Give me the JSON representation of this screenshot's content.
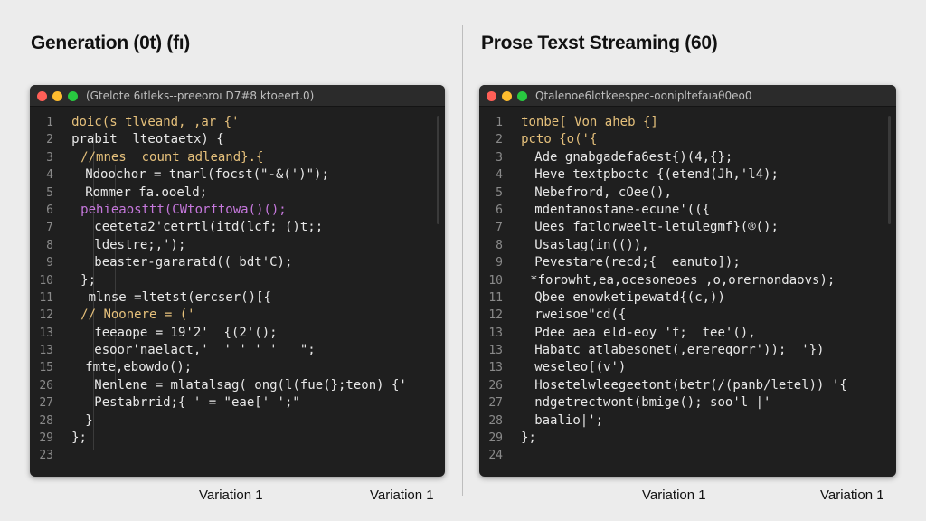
{
  "left": {
    "heading": "Generation (0t)  (fı)",
    "window_title": "(Gtelote 6ıtleks--preeoroı D7#8 ktoeert.0)",
    "lines": [
      {
        "n": "1",
        "indent": 2,
        "color": "c-y",
        "text": "doic(s tlveand, ,ar {'"
      },
      {
        "n": "2",
        "indent": 2,
        "color": "c-w",
        "text": "prabit  lteotaetx) {"
      },
      {
        "n": "3",
        "indent": 4,
        "color": "c-y",
        "text": "//mnes  count adleand}.{"
      },
      {
        "n": "4",
        "indent": 5,
        "color": "c-w",
        "text": "Ndoochor = tnarl(focst(\"-&(')\");"
      },
      {
        "n": "5",
        "indent": 5,
        "color": "c-w",
        "text": "Rommer fa.ooeld;"
      },
      {
        "n": "6",
        "indent": 4,
        "color": "c-p",
        "text": "pehieaosttt(CWtorftowa()();"
      },
      {
        "n": "7",
        "indent": 7,
        "color": "c-w",
        "text": "ceeteta2'cetrtl(itd(lcf; ()t;;"
      },
      {
        "n": "8",
        "indent": 7,
        "color": "c-w",
        "text": "ldestre;,');"
      },
      {
        "n": "9",
        "indent": 7,
        "color": "c-w",
        "text": "beaster-gararatd(( bdt'C);"
      },
      {
        "n": "10",
        "indent": 4,
        "color": "c-w",
        "text": "};"
      },
      {
        "n": "11",
        "indent": 4,
        "color": "c-w",
        "text": " mlnse =ltetst(ercser()[{"
      },
      {
        "n": "12",
        "indent": 4,
        "color": "c-y",
        "text": "// Noonere = ('"
      },
      {
        "n": "13",
        "indent": 7,
        "color": "c-w",
        "text": "feeaope = 19'2'  {(2'();"
      },
      {
        "n": "13",
        "indent": 7,
        "color": "c-w",
        "text": "esoor'naelact,'  ' ' ' '   \";"
      },
      {
        "n": "15",
        "indent": 5,
        "color": "c-w",
        "text": "fmte,ebowdo();"
      },
      {
        "n": "26",
        "indent": 7,
        "color": "c-w",
        "text": "Nenlene = mlatalsag( ong(l(fue(};teon) {'"
      },
      {
        "n": "27",
        "indent": 7,
        "color": "c-w",
        "text": "Pestabrrid;{ ' = \"eae[' ';\""
      },
      {
        "n": "28",
        "indent": 5,
        "color": "c-w",
        "text": "}"
      },
      {
        "n": "29",
        "indent": 2,
        "color": "c-w",
        "text": "};"
      },
      {
        "n": "23",
        "indent": 2,
        "color": "c-w",
        "text": ""
      }
    ],
    "caption_left": "Variation 1",
    "caption_right": "Variation 1"
  },
  "right": {
    "heading": "Prose Texst Streaming (60)",
    "window_title": "Qtalenoe6lotkeespec-oonipltefaıaθ0eo0",
    "lines": [
      {
        "n": "1",
        "indent": 2,
        "color": "c-y",
        "text": "tonbe[ Von aheb {]"
      },
      {
        "n": "2",
        "indent": 2,
        "color": "c-y",
        "text": "pcto {o('{"
      },
      {
        "n": "3",
        "indent": 5,
        "color": "c-w",
        "text": "Ade gnabgadefa6est{)(4,{};"
      },
      {
        "n": "4",
        "indent": 5,
        "color": "c-w",
        "text": "Heve textpboctc {(etend(Jh,'l4);"
      },
      {
        "n": "5",
        "indent": 5,
        "color": "c-w",
        "text": "Nebefrord, cOee(),"
      },
      {
        "n": "6",
        "indent": 5,
        "color": "c-w",
        "text": "mdentanostane-ecune'(({"
      },
      {
        "n": "7",
        "indent": 5,
        "color": "c-w",
        "text": "Uees fatlorweelt-letulegmf}(®();"
      },
      {
        "n": "8",
        "indent": 5,
        "color": "c-w",
        "text": "Usaslag(in(()),"
      },
      {
        "n": "9",
        "indent": 5,
        "color": "c-w",
        "text": "Pevestare(recd;{  eanuto]);"
      },
      {
        "n": "10",
        "indent": 4,
        "color": "c-w",
        "text": "*forowht,ea,ocesoneoes ,o,orernondaovs);"
      },
      {
        "n": "11",
        "indent": 5,
        "color": "c-w",
        "text": "Qbee enowketipewatd{(c,))"
      },
      {
        "n": "12",
        "indent": 5,
        "color": "c-w",
        "text": "rweisoe\"cd({"
      },
      {
        "n": "13",
        "indent": 5,
        "color": "c-w",
        "text": "Pdee aea eld-eoy 'f;  tee'(),"
      },
      {
        "n": "13",
        "indent": 5,
        "color": "c-w",
        "text": "Habatc atlabesonet(,erereqorr'));  '})"
      },
      {
        "n": "13",
        "indent": 5,
        "color": "c-w",
        "text": "weseleo[(v')"
      },
      {
        "n": "26",
        "indent": 5,
        "color": "c-w",
        "text": "Hosetelwleegeetont(betr(/(panb/letel)) '{"
      },
      {
        "n": "27",
        "indent": 5,
        "color": "c-w",
        "text": "ndgetrectwont(bmige(); soo'l |'"
      },
      {
        "n": "28",
        "indent": 5,
        "color": "c-w",
        "text": "baalio|';"
      },
      {
        "n": "29",
        "indent": 2,
        "color": "c-w",
        "text": "};"
      },
      {
        "n": "24",
        "indent": 2,
        "color": "c-w",
        "text": ""
      }
    ],
    "caption_left": "Variation 1",
    "caption_right": "Variation 1"
  }
}
